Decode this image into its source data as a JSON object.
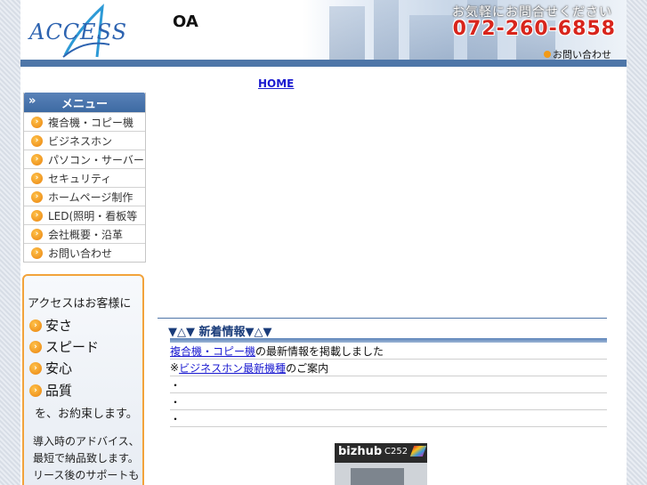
{
  "header": {
    "logo_text": "ACCESS",
    "site_title": "OA",
    "tagline": "お気軽にお問合せください",
    "phone": "072-260-6858",
    "contact_link": "お問い合わせ"
  },
  "nav": {
    "home": "HOME",
    "link2": "",
    "link3": "",
    "link4": ""
  },
  "sidebar": {
    "title": "メニュー",
    "items": [
      {
        "label": "複合機・コピー機"
      },
      {
        "label": "ビジネスホン"
      },
      {
        "label": "パソコン・サーバー"
      },
      {
        "label": "セキュリティ"
      },
      {
        "label": "ホームページ制作"
      },
      {
        "label": "LED(照明・看板等"
      },
      {
        "label": "会社概要・沿革"
      },
      {
        "label": "お問い合わせ"
      }
    ]
  },
  "promo": {
    "intro": "アクセスはお客様に",
    "points": [
      "安さ",
      "スピード",
      "安心",
      "品質"
    ],
    "closing": "を、お約束します。",
    "note1": "導入時のアドバイス、",
    "note2": "最短で納品致します。",
    "note3": "リース後のサポートも"
  },
  "content": {
    "section_title": "▼△▼ 新着情報▼△▼",
    "rows": [
      {
        "link": "複合機・コピー機",
        "text": "の最新情報を掲載しました"
      },
      {
        "prefix": "※",
        "link": "ビジネスホン最新機種",
        "text": "のご案内"
      },
      {
        "text": "・"
      },
      {
        "text": "・"
      },
      {
        "text": "・"
      }
    ],
    "product_brand": "bizhub",
    "product_model": "C252"
  },
  "colors": {
    "accent": "#4e76a8",
    "orange": "#f29a17",
    "link": "#1a1ad0",
    "phone": "#d8251c"
  }
}
